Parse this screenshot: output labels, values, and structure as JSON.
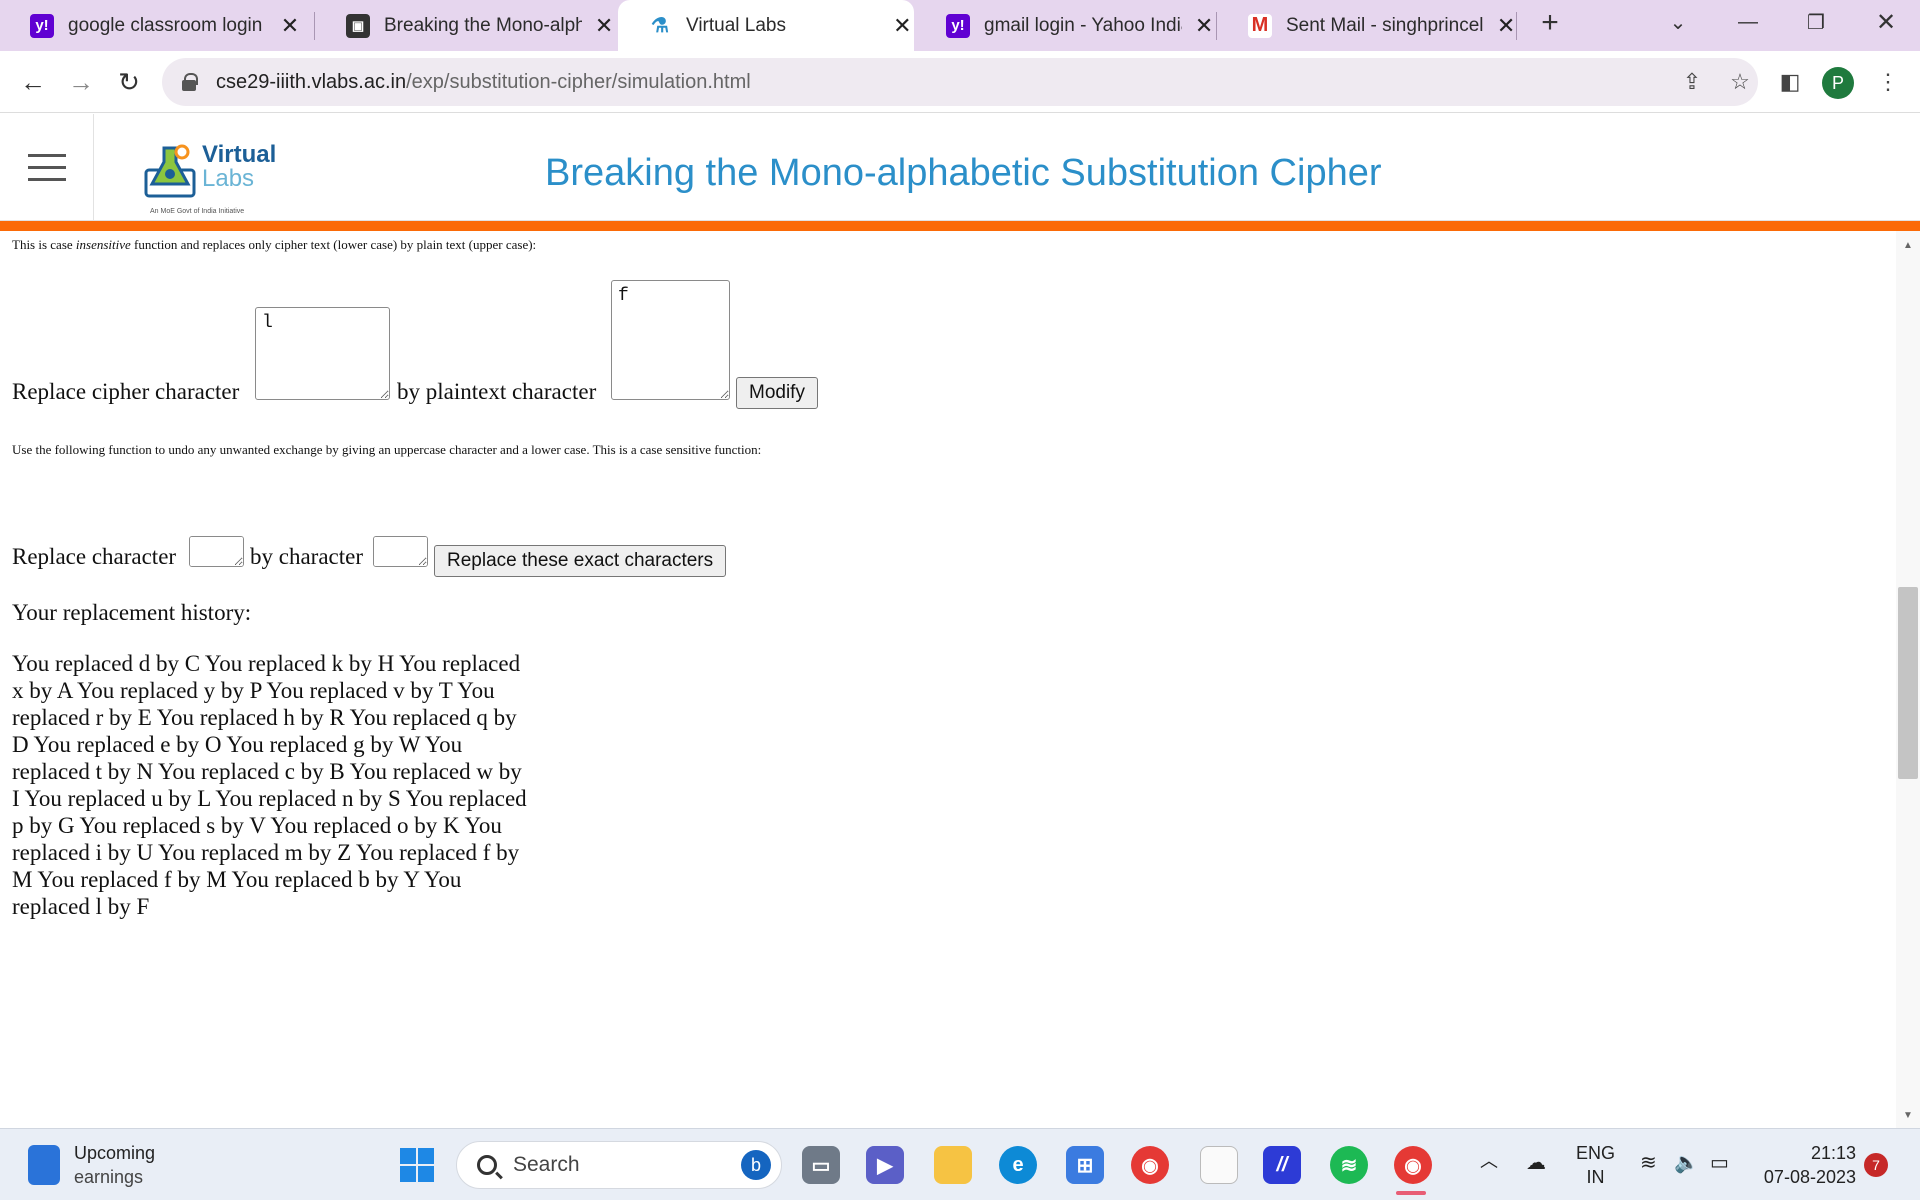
{
  "browser": {
    "tabs": [
      {
        "title": "google classroom login - ",
        "icon": "yahoo-icon",
        "icon_text": "y!",
        "color": "#6001d2",
        "active": false
      },
      {
        "title": "Breaking the Mono-alphab",
        "icon": "classroom-icon",
        "icon_text": "▣",
        "color": "#333333",
        "active": false
      },
      {
        "title": "Virtual Labs",
        "icon": "virtual-labs-icon",
        "icon_text": "⚗",
        "color": "#2b8fc9",
        "active": true
      },
      {
        "title": "gmail login - Yahoo India",
        "icon": "yahoo-icon",
        "icon_text": "y!",
        "color": "#6001d2",
        "active": false
      },
      {
        "title": "Sent Mail - singhprincelax",
        "icon": "gmail-icon",
        "icon_text": "M",
        "color": "#d93025",
        "active": false
      }
    ],
    "new_tab": "+",
    "url_host": "cse29-iiith.vlabs.ac.in",
    "url_path": "/exp/substitution-cipher/simulation.html",
    "profile_initial": "P"
  },
  "site": {
    "logo_main": "Virtual",
    "logo_sub": "Labs",
    "logo_tag": "An MoE Govt of India Initiative",
    "title": "Breaking the Mono-alphabetic Substitution Cipher"
  },
  "content": {
    "note1_before": "This is case ",
    "note1_em": "insensitive",
    "note1_after": " function and replaces only cipher text (lower case) by plain text (upper case):",
    "replace_cipher_label": "Replace cipher character",
    "cipher_value": "l",
    "by_plaintext_label": "by plaintext character",
    "plain_value": "f",
    "modify_button": "Modify",
    "note2": "Use the following function to undo any unwanted exchange by giving an uppercase character and a lower case. This is a case sensitive function:",
    "replace_char_label": "Replace character",
    "by_char_label": "by character",
    "exact_button": "Replace these exact characters",
    "history_title": "Your replacement history:",
    "history_text": "You replaced d by C You replaced k by H You replaced x by A You replaced y by P You replaced v by T You replaced r by E You replaced h by R You replaced q by D You replaced e by O You replaced g by W You replaced t by N You replaced c by B You replaced w by I You replaced u by L You replaced n by S You replaced p by G You replaced s by V You replaced o by K You replaced i by U You replaced m by Z You replaced f by M You replaced f by M You replaced b by Y You replaced l by F"
  },
  "taskbar": {
    "weather_title": "Upcoming",
    "weather_sub": "earnings",
    "search_placeholder": "Search",
    "lang_top": "ENG",
    "lang_bottom": "IN",
    "time": "21:13",
    "date": "07-08-2023",
    "notification_count": "7"
  }
}
